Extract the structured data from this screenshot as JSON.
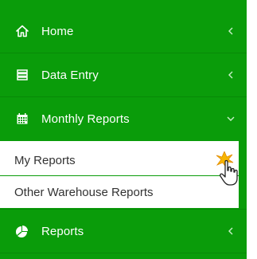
{
  "sidebar": {
    "accent_color": "#0a9c0a",
    "items": [
      {
        "label": "Home",
        "icon": "home-icon",
        "expanded": false
      },
      {
        "label": "Data Entry",
        "icon": "list-icon",
        "expanded": false
      },
      {
        "label": "Monthly Reports",
        "icon": "calendar-icon",
        "expanded": true,
        "children": [
          {
            "label": "My Reports"
          },
          {
            "label": "Other Warehouse Reports"
          }
        ]
      },
      {
        "label": "Reports",
        "icon": "pie-chart-icon",
        "expanded": false
      }
    ]
  },
  "cursor": {
    "icon": "hand-pointer-click-icon"
  }
}
